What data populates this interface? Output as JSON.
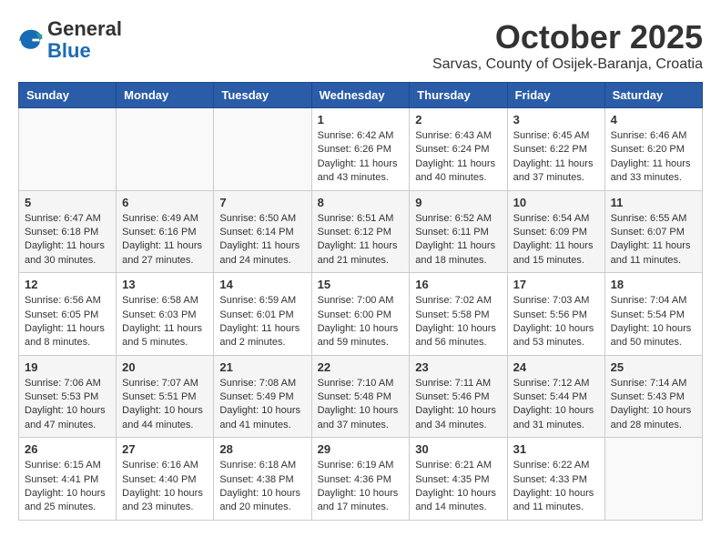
{
  "header": {
    "logo_general": "General",
    "logo_blue": "Blue",
    "month": "October 2025",
    "location": "Sarvas, County of Osijek-Baranja, Croatia"
  },
  "weekdays": [
    "Sunday",
    "Monday",
    "Tuesday",
    "Wednesday",
    "Thursday",
    "Friday",
    "Saturday"
  ],
  "weeks": [
    [
      {
        "day": "",
        "info": ""
      },
      {
        "day": "",
        "info": ""
      },
      {
        "day": "",
        "info": ""
      },
      {
        "day": "1",
        "info": "Sunrise: 6:42 AM\nSunset: 6:26 PM\nDaylight: 11 hours\nand 43 minutes."
      },
      {
        "day": "2",
        "info": "Sunrise: 6:43 AM\nSunset: 6:24 PM\nDaylight: 11 hours\nand 40 minutes."
      },
      {
        "day": "3",
        "info": "Sunrise: 6:45 AM\nSunset: 6:22 PM\nDaylight: 11 hours\nand 37 minutes."
      },
      {
        "day": "4",
        "info": "Sunrise: 6:46 AM\nSunset: 6:20 PM\nDaylight: 11 hours\nand 33 minutes."
      }
    ],
    [
      {
        "day": "5",
        "info": "Sunrise: 6:47 AM\nSunset: 6:18 PM\nDaylight: 11 hours\nand 30 minutes."
      },
      {
        "day": "6",
        "info": "Sunrise: 6:49 AM\nSunset: 6:16 PM\nDaylight: 11 hours\nand 27 minutes."
      },
      {
        "day": "7",
        "info": "Sunrise: 6:50 AM\nSunset: 6:14 PM\nDaylight: 11 hours\nand 24 minutes."
      },
      {
        "day": "8",
        "info": "Sunrise: 6:51 AM\nSunset: 6:12 PM\nDaylight: 11 hours\nand 21 minutes."
      },
      {
        "day": "9",
        "info": "Sunrise: 6:52 AM\nSunset: 6:11 PM\nDaylight: 11 hours\nand 18 minutes."
      },
      {
        "day": "10",
        "info": "Sunrise: 6:54 AM\nSunset: 6:09 PM\nDaylight: 11 hours\nand 15 minutes."
      },
      {
        "day": "11",
        "info": "Sunrise: 6:55 AM\nSunset: 6:07 PM\nDaylight: 11 hours\nand 11 minutes."
      }
    ],
    [
      {
        "day": "12",
        "info": "Sunrise: 6:56 AM\nSunset: 6:05 PM\nDaylight: 11 hours\nand 8 minutes."
      },
      {
        "day": "13",
        "info": "Sunrise: 6:58 AM\nSunset: 6:03 PM\nDaylight: 11 hours\nand 5 minutes."
      },
      {
        "day": "14",
        "info": "Sunrise: 6:59 AM\nSunset: 6:01 PM\nDaylight: 11 hours\nand 2 minutes."
      },
      {
        "day": "15",
        "info": "Sunrise: 7:00 AM\nSunset: 6:00 PM\nDaylight: 10 hours\nand 59 minutes."
      },
      {
        "day": "16",
        "info": "Sunrise: 7:02 AM\nSunset: 5:58 PM\nDaylight: 10 hours\nand 56 minutes."
      },
      {
        "day": "17",
        "info": "Sunrise: 7:03 AM\nSunset: 5:56 PM\nDaylight: 10 hours\nand 53 minutes."
      },
      {
        "day": "18",
        "info": "Sunrise: 7:04 AM\nSunset: 5:54 PM\nDaylight: 10 hours\nand 50 minutes."
      }
    ],
    [
      {
        "day": "19",
        "info": "Sunrise: 7:06 AM\nSunset: 5:53 PM\nDaylight: 10 hours\nand 47 minutes."
      },
      {
        "day": "20",
        "info": "Sunrise: 7:07 AM\nSunset: 5:51 PM\nDaylight: 10 hours\nand 44 minutes."
      },
      {
        "day": "21",
        "info": "Sunrise: 7:08 AM\nSunset: 5:49 PM\nDaylight: 10 hours\nand 41 minutes."
      },
      {
        "day": "22",
        "info": "Sunrise: 7:10 AM\nSunset: 5:48 PM\nDaylight: 10 hours\nand 37 minutes."
      },
      {
        "day": "23",
        "info": "Sunrise: 7:11 AM\nSunset: 5:46 PM\nDaylight: 10 hours\nand 34 minutes."
      },
      {
        "day": "24",
        "info": "Sunrise: 7:12 AM\nSunset: 5:44 PM\nDaylight: 10 hours\nand 31 minutes."
      },
      {
        "day": "25",
        "info": "Sunrise: 7:14 AM\nSunset: 5:43 PM\nDaylight: 10 hours\nand 28 minutes."
      }
    ],
    [
      {
        "day": "26",
        "info": "Sunrise: 6:15 AM\nSunset: 4:41 PM\nDaylight: 10 hours\nand 25 minutes."
      },
      {
        "day": "27",
        "info": "Sunrise: 6:16 AM\nSunset: 4:40 PM\nDaylight: 10 hours\nand 23 minutes."
      },
      {
        "day": "28",
        "info": "Sunrise: 6:18 AM\nSunset: 4:38 PM\nDaylight: 10 hours\nand 20 minutes."
      },
      {
        "day": "29",
        "info": "Sunrise: 6:19 AM\nSunset: 4:36 PM\nDaylight: 10 hours\nand 17 minutes."
      },
      {
        "day": "30",
        "info": "Sunrise: 6:21 AM\nSunset: 4:35 PM\nDaylight: 10 hours\nand 14 minutes."
      },
      {
        "day": "31",
        "info": "Sunrise: 6:22 AM\nSunset: 4:33 PM\nDaylight: 10 hours\nand 11 minutes."
      },
      {
        "day": "",
        "info": ""
      }
    ]
  ]
}
